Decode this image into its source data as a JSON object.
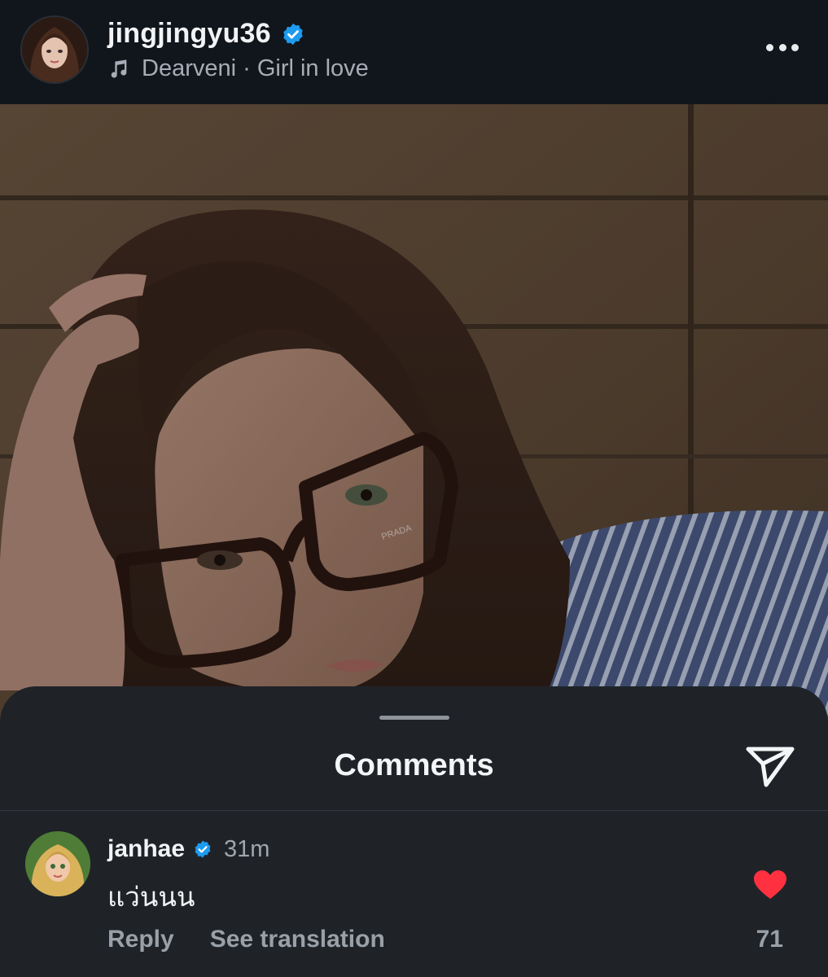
{
  "post": {
    "username": "jingjingyu36",
    "music": "Dearveni · Girl in love",
    "icons": {
      "avatar": "profile-photo",
      "verified": "verified-badge-icon",
      "music": "music-note-icon",
      "more": "more-horizontal-icon"
    }
  },
  "photo": {
    "description_alt": "",
    "brand_text": "PRADA"
  },
  "comments_sheet": {
    "title": "Comments",
    "share_icon": "send-icon",
    "comment": {
      "username": "janhae",
      "time": "31m",
      "text": "แว่นนน",
      "reply_label": "Reply",
      "translate_label": "See translation",
      "likes": "71",
      "liked": true
    }
  },
  "colors": {
    "verified": "#1d9bf0",
    "heart": "#ff3040",
    "sheet_bg": "#1f2328",
    "header_bg": "#10161c"
  }
}
